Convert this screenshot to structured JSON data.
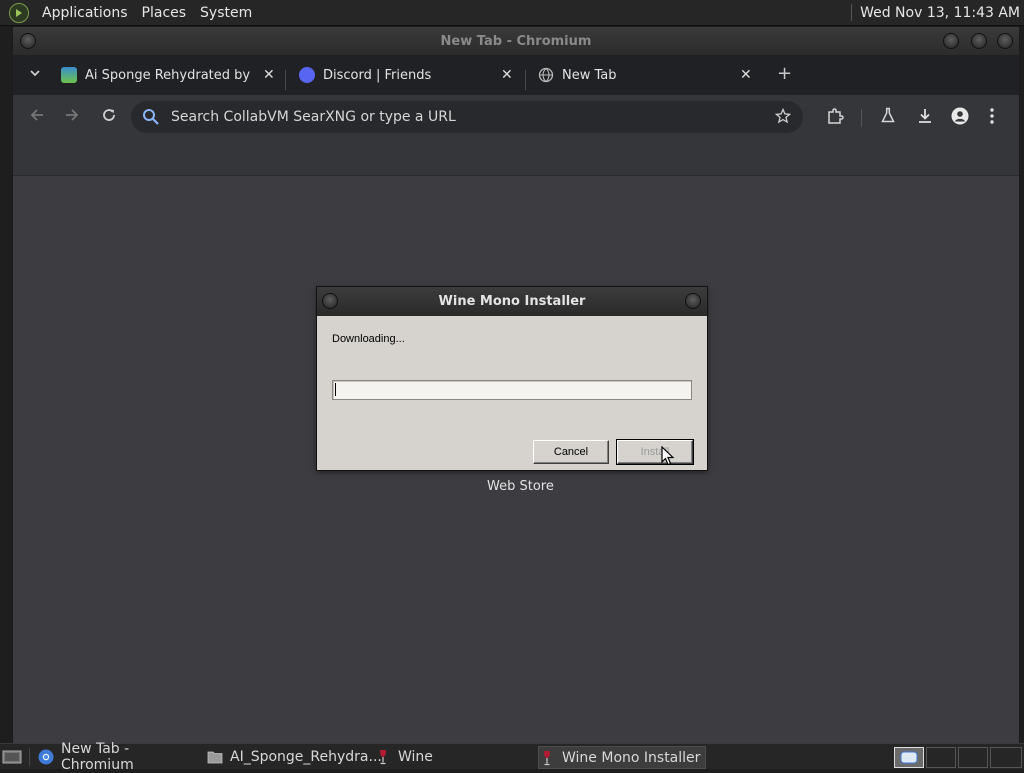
{
  "top_panel": {
    "menus": [
      "Applications",
      "Places",
      "System"
    ],
    "clock": "Wed Nov 13, 11:43 AM"
  },
  "browser": {
    "window_title": "New Tab - Chromium",
    "tabs": [
      {
        "title": "Ai Sponge Rehydrated by Po",
        "icon": "sponge-favicon"
      },
      {
        "title": "Discord | Friends",
        "icon": "discord-favicon"
      },
      {
        "title": "New Tab",
        "icon": "globe-favicon"
      }
    ],
    "omnibox_placeholder": "Search CollabVM SearXNG or type a URL",
    "shortcut_label": "Web Store"
  },
  "dialog": {
    "title": "Wine Mono Installer",
    "status": "Downloading...",
    "progress": 0,
    "cancel_label": "Cancel",
    "install_label": "Install"
  },
  "taskbar": {
    "items": [
      {
        "label": "New Tab - Chromium",
        "icon": "chromium-icon"
      },
      {
        "label": "AI_Sponge_Rehydra...",
        "icon": "folder-icon"
      },
      {
        "label": "Wine",
        "icon": "wine-glass-icon"
      },
      {
        "label": "Wine Mono Installer",
        "icon": "wine-glass-icon"
      }
    ]
  },
  "colors": {
    "panel": "#262626",
    "browser_frame": "#202124",
    "toolbar": "#35363a",
    "page_bg": "#3c3c41",
    "dialog_bg": "#d6d3ce",
    "accent_blue": "#8ab4f8"
  }
}
